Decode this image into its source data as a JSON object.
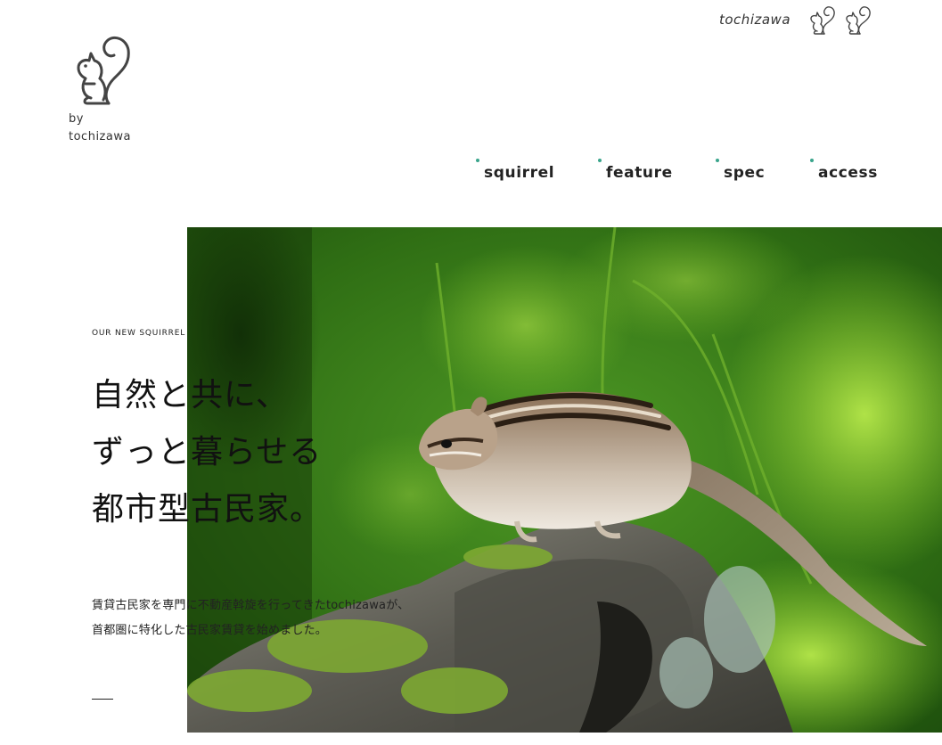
{
  "header": {
    "logo_icon": "squirrel-logo-icon",
    "logo_by": "by",
    "logo_name": "tochizawa",
    "brand": "tochizawa",
    "top_icons": [
      "squirrel-icon",
      "squirrel-icon"
    ]
  },
  "nav": {
    "items": [
      {
        "label": "squirrel"
      },
      {
        "label": "feature"
      },
      {
        "label": "spec"
      },
      {
        "label": "access"
      }
    ],
    "dot_color": "#3aa58c"
  },
  "hero": {
    "image": "chipmunk-on-log-photo",
    "eyebrow": "OUR NEW SQUIRREL",
    "headline": [
      "自然と共に、",
      "ずっと暮らせる",
      "都市型古民家。"
    ],
    "body": [
      "賃貸古民家を専門に不動産斡旋を行ってきたtochizawaが、",
      "首都圏に特化した古民家賃貸を始めました。"
    ]
  }
}
